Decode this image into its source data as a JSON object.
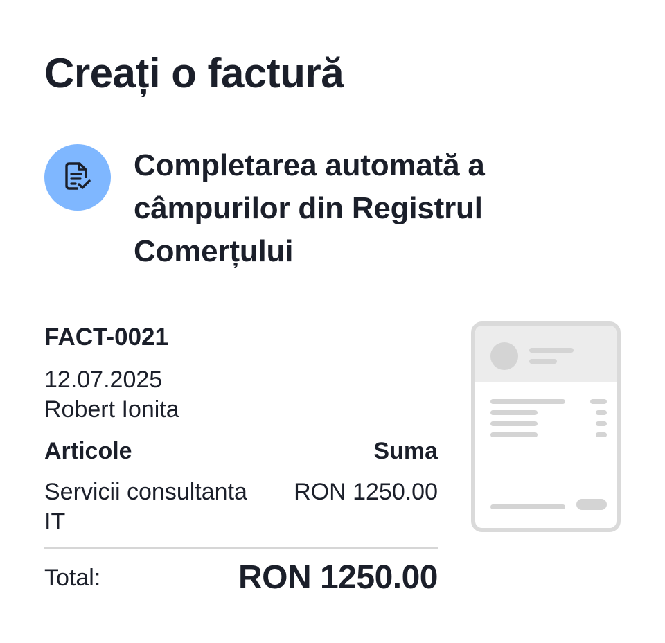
{
  "page": {
    "title": "Creați o factură"
  },
  "feature": {
    "icon": "document-check-icon",
    "text": "Completarea automată a câmpurilor din Registrul Comerțului"
  },
  "invoice": {
    "number": "FACT-0021",
    "date": "12.07.2025",
    "client": "Robert Ionita",
    "columns": {
      "items": "Articole",
      "amount": "Suma"
    },
    "items": [
      {
        "name": "Servicii consultanta IT",
        "amount": "RON 1250.00"
      }
    ],
    "total_label": "Total:",
    "total_value": "RON 1250.00"
  },
  "colors": {
    "badge": "#7fb7ff",
    "text": "#1b1f2a",
    "preview_border": "#dadada"
  }
}
